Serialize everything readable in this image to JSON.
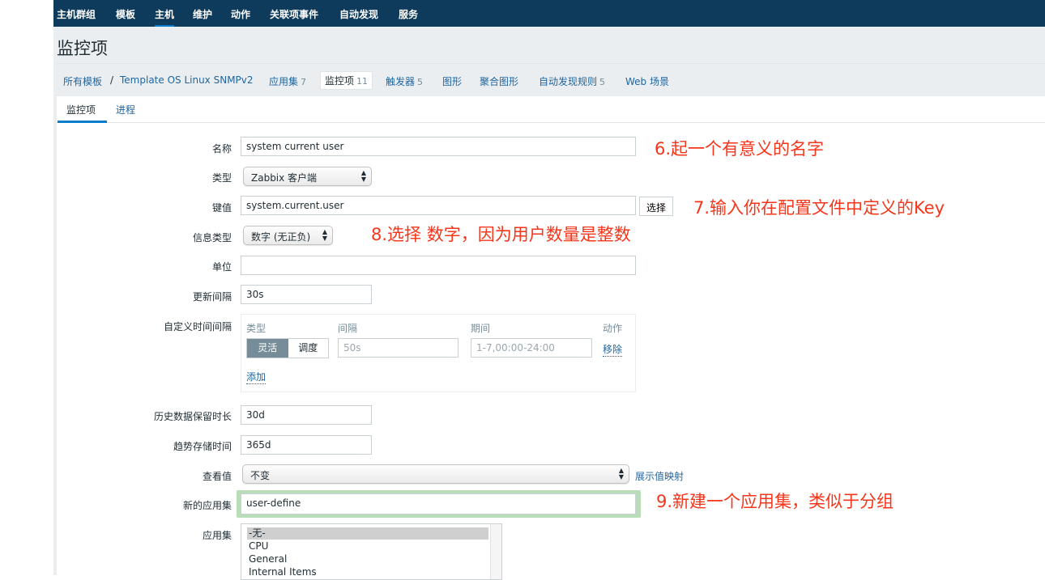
{
  "nav": {
    "items": [
      "主机群组",
      "模板",
      "主机",
      "维护",
      "动作",
      "关联项事件",
      "自动发现",
      "服务"
    ],
    "active": 2
  },
  "page_title": "监控项",
  "breadcrumb": {
    "root": "所有模板",
    "separator": "/",
    "template": "Template OS Linux SNMPv2",
    "tabs": [
      {
        "label": "应用集",
        "count": "7"
      },
      {
        "label": "监控项",
        "count": "11"
      },
      {
        "label": "触发器",
        "count": "5"
      },
      {
        "label": "图形",
        "count": ""
      },
      {
        "label": "聚合图形",
        "count": ""
      },
      {
        "label": "自动发现规则",
        "count": "5"
      },
      {
        "label": "Web 场景",
        "count": ""
      }
    ]
  },
  "subtabs": [
    "监控项",
    "进程"
  ],
  "form": {
    "name": {
      "label": "名称",
      "value": "system current user"
    },
    "type": {
      "label": "类型",
      "value": "Zabbix 客户端"
    },
    "key": {
      "label": "键值",
      "value": "system.current.user",
      "button": "选择"
    },
    "info_type": {
      "label": "信息类型",
      "value": "数字 (无正负)"
    },
    "units": {
      "label": "单位",
      "value": ""
    },
    "update_interval": {
      "label": "更新间隔",
      "value": "30s"
    },
    "custom_intervals": {
      "label": "自定义时间间隔",
      "col_type": "类型",
      "col_interval": "间隔",
      "col_period": "期间",
      "col_action": "动作",
      "mode_flexible": "灵活",
      "mode_scheduling": "调度",
      "interval_placeholder": "50s",
      "period_placeholder": "1-7,00:00-24:00",
      "remove": "移除",
      "add": "添加"
    },
    "history": {
      "label": "历史数据保留时长",
      "value": "30d"
    },
    "trends": {
      "label": "趋势存储时间",
      "value": "365d"
    },
    "show_value": {
      "label": "查看值",
      "value": "不变",
      "link": "展示值映射"
    },
    "new_application": {
      "label": "新的应用集",
      "value": "user-define"
    },
    "applications": {
      "label": "应用集",
      "options": [
        "-无-",
        "CPU",
        "General",
        "Internal Items"
      ],
      "selected": 0
    }
  },
  "notes": {
    "n6": "6.起一个有意义的名字",
    "n7": "7.输入你在配置文件中定义的Key",
    "n8": "8.选择 数字，因为用户数量是整数",
    "n9": "9.新建一个应用集，类似于分组"
  },
  "colors": {
    "nav": "#0e3b5c",
    "link": "#1f65a0",
    "note": "#f5361b",
    "highlight": "#b9ddb9"
  }
}
